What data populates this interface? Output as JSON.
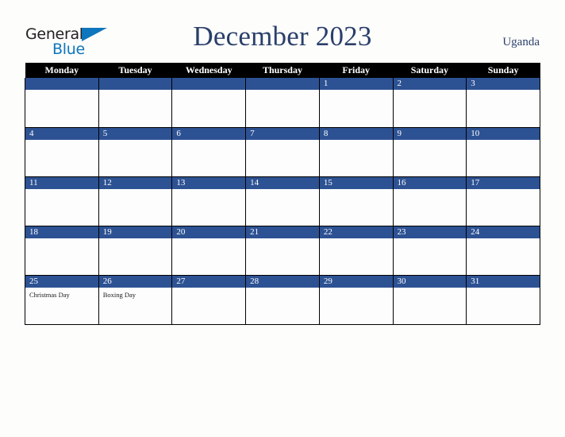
{
  "brand": {
    "name_top": "General",
    "name_bottom": "Blue",
    "triangle_icon": "blue-triangle-icon",
    "color_top": "#231f20",
    "color_bottom": "#0e76bc"
  },
  "header": {
    "title": "December 2023",
    "country": "Uganda",
    "title_color": "#2a3f6b"
  },
  "theme": {
    "day_band": "#2d5293",
    "weekday_header_bg": "#000000",
    "weekday_header_fg": "#ffffff",
    "cell_bg": "#fdfdfd",
    "page_bg": "#fdfdfb",
    "grid_line": "#000000"
  },
  "weekdays": [
    "Monday",
    "Tuesday",
    "Wednesday",
    "Thursday",
    "Friday",
    "Saturday",
    "Sunday"
  ],
  "weeks": [
    [
      {
        "day": "",
        "events": []
      },
      {
        "day": "",
        "events": []
      },
      {
        "day": "",
        "events": []
      },
      {
        "day": "",
        "events": []
      },
      {
        "day": "1",
        "events": []
      },
      {
        "day": "2",
        "events": []
      },
      {
        "day": "3",
        "events": []
      }
    ],
    [
      {
        "day": "4",
        "events": []
      },
      {
        "day": "5",
        "events": []
      },
      {
        "day": "6",
        "events": []
      },
      {
        "day": "7",
        "events": []
      },
      {
        "day": "8",
        "events": []
      },
      {
        "day": "9",
        "events": []
      },
      {
        "day": "10",
        "events": []
      }
    ],
    [
      {
        "day": "11",
        "events": []
      },
      {
        "day": "12",
        "events": []
      },
      {
        "day": "13",
        "events": []
      },
      {
        "day": "14",
        "events": []
      },
      {
        "day": "15",
        "events": []
      },
      {
        "day": "16",
        "events": []
      },
      {
        "day": "17",
        "events": []
      }
    ],
    [
      {
        "day": "18",
        "events": []
      },
      {
        "day": "19",
        "events": []
      },
      {
        "day": "20",
        "events": []
      },
      {
        "day": "21",
        "events": []
      },
      {
        "day": "22",
        "events": []
      },
      {
        "day": "23",
        "events": []
      },
      {
        "day": "24",
        "events": []
      }
    ],
    [
      {
        "day": "25",
        "events": [
          "Christmas Day"
        ]
      },
      {
        "day": "26",
        "events": [
          "Boxing Day"
        ]
      },
      {
        "day": "27",
        "events": []
      },
      {
        "day": "28",
        "events": []
      },
      {
        "day": "29",
        "events": []
      },
      {
        "day": "30",
        "events": []
      },
      {
        "day": "31",
        "events": []
      }
    ]
  ]
}
